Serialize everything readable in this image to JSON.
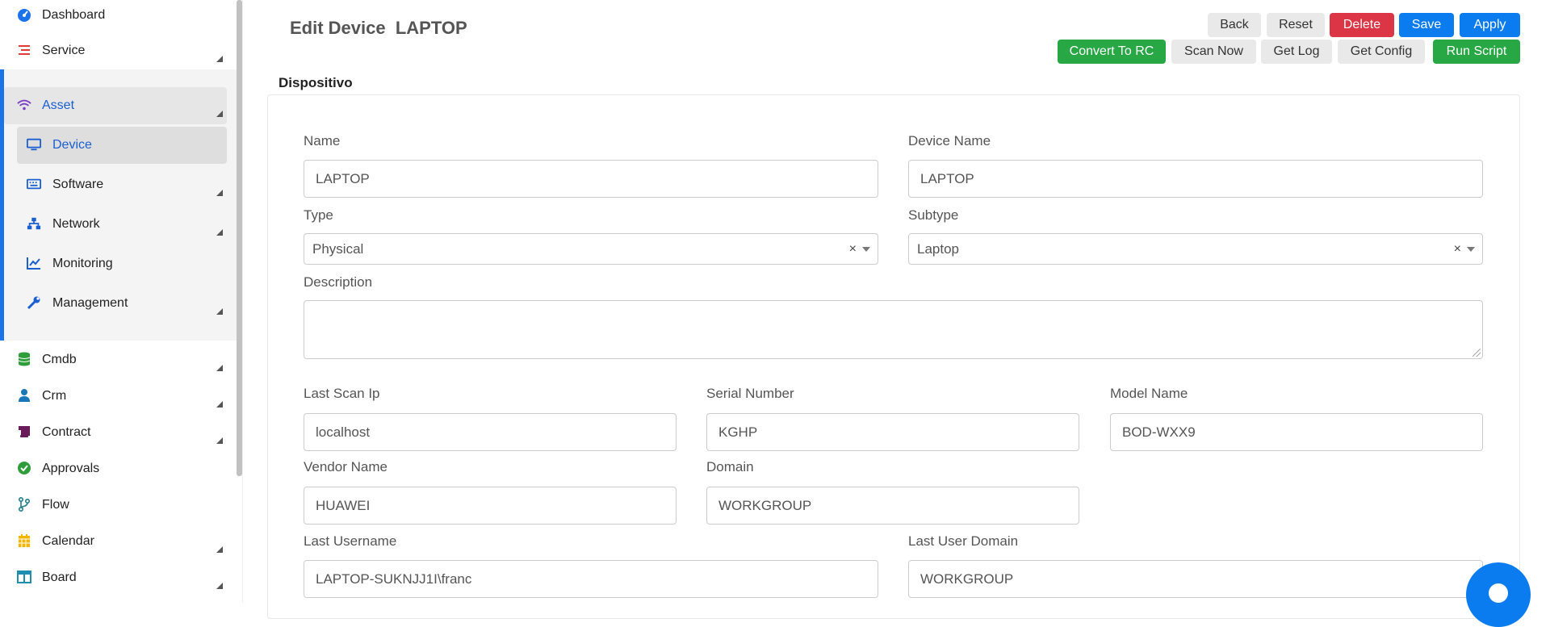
{
  "sidebar": {
    "items": [
      {
        "label": "Dashboard",
        "icon": "dashboard-icon"
      },
      {
        "label": "Service",
        "icon": "list-icon"
      },
      {
        "label": "Asset",
        "icon": "wifi-icon"
      },
      {
        "label": "Device",
        "icon": "monitor-icon"
      },
      {
        "label": "Software",
        "icon": "keyboard-icon"
      },
      {
        "label": "Network",
        "icon": "network-icon"
      },
      {
        "label": "Monitoring",
        "icon": "chart-line-icon"
      },
      {
        "label": "Management",
        "icon": "wrench-icon"
      },
      {
        "label": "Cmdb",
        "icon": "database-icon"
      },
      {
        "label": "Crm",
        "icon": "user-icon"
      },
      {
        "label": "Contract",
        "icon": "scroll-icon"
      },
      {
        "label": "Approvals",
        "icon": "check-circle-icon"
      },
      {
        "label": "Flow",
        "icon": "branch-icon"
      },
      {
        "label": "Calendar",
        "icon": "calendar-icon"
      },
      {
        "label": "Board",
        "icon": "board-icon"
      }
    ]
  },
  "header": {
    "title_prefix": "Edit Device",
    "title_name": "LAPTOP",
    "buttons": {
      "back": "Back",
      "reset": "Reset",
      "delete": "Delete",
      "save": "Save",
      "apply": "Apply",
      "convert": "Convert To RC",
      "scan_now": "Scan Now",
      "get_log": "Get Log",
      "get_config": "Get Config",
      "run_script": "Run Script"
    }
  },
  "form": {
    "section_title": "Dispositivo",
    "name": {
      "label": "Name",
      "value": "LAPTOP"
    },
    "device_name": {
      "label": "Device Name",
      "value": "LAPTOP"
    },
    "type": {
      "label": "Type",
      "value": "Physical"
    },
    "subtype": {
      "label": "Subtype",
      "value": "Laptop"
    },
    "description": {
      "label": "Description",
      "value": ""
    },
    "last_scan_ip": {
      "label": "Last Scan Ip",
      "value": "localhost"
    },
    "serial_number": {
      "label": "Serial Number",
      "value": "KGHP"
    },
    "model_name": {
      "label": "Model Name",
      "value": "BOD-WXX9"
    },
    "vendor_name": {
      "label": "Vendor Name",
      "value": "HUAWEI"
    },
    "domain": {
      "label": "Domain",
      "value": "WORKGROUP"
    },
    "last_username": {
      "label": "Last Username",
      "value": "LAPTOP-SUKNJJ1I\\franc"
    },
    "last_user_domain": {
      "label": "Last User Domain",
      "value": "WORKGROUP"
    },
    "clear_symbol": "×"
  },
  "colors": {
    "accent": "#0a7cf0",
    "danger": "#dc3545",
    "success": "#28a745"
  }
}
